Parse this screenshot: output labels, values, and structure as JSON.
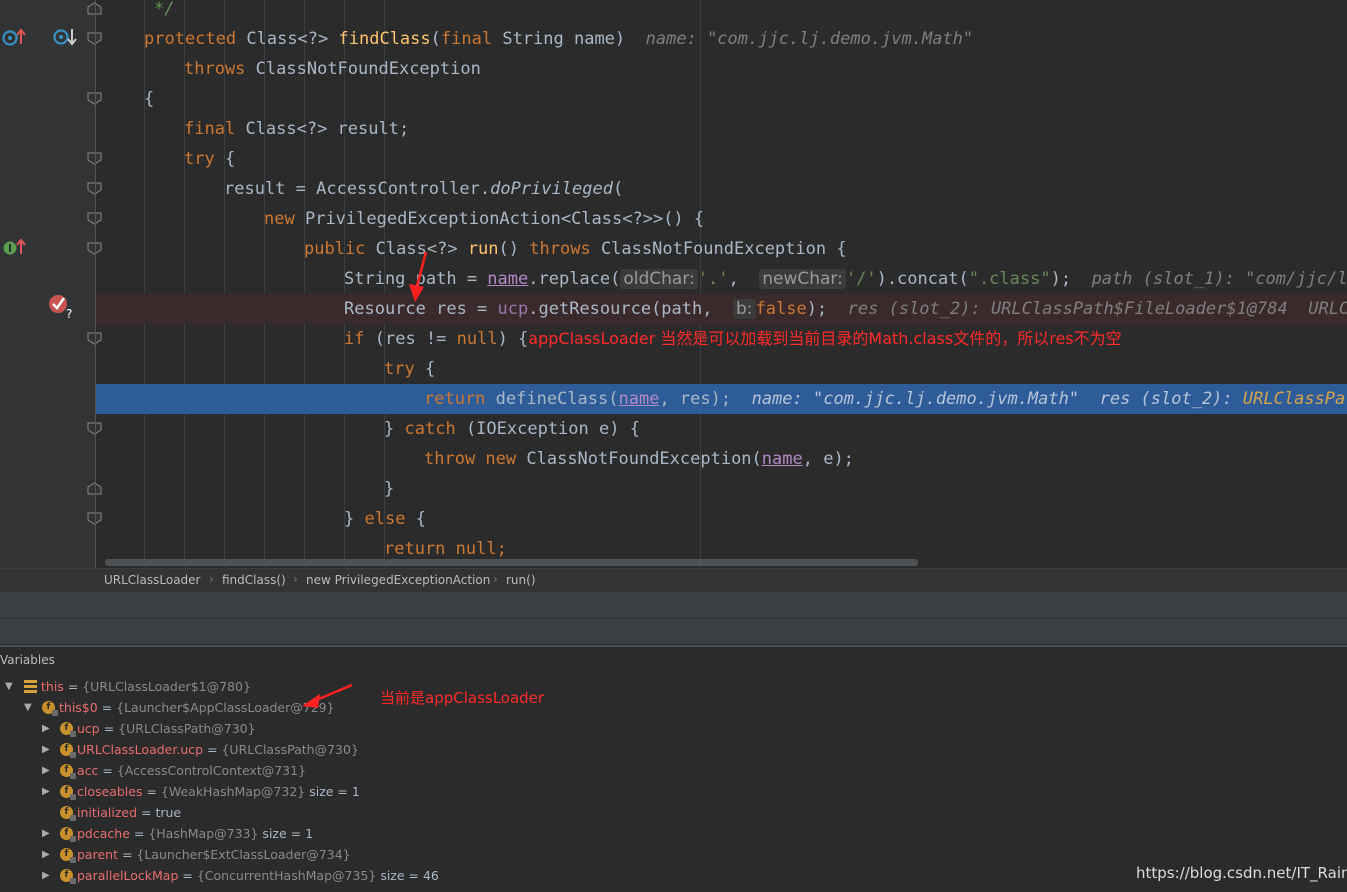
{
  "code_lines": {
    "l0": "*/",
    "l1_protected": "protected",
    "l1_class": "Class<?>",
    "l1_fn": "findClass",
    "l1_paren": "(",
    "l1_final": "final",
    "l1_rest": "String name)",
    "l1_hint": "name: \"com.jjc.lj.demo.jvm.Math\"",
    "l2_throws": "throws",
    "l2_rest": "ClassNotFoundException",
    "l3": "{",
    "l4_final": "final",
    "l4_rest": "Class<?> result;",
    "l5_try": "try",
    "l5_rest": "{",
    "l6_a": "result = AccessController.",
    "l6_fn": "doPrivileged",
    "l6_b": "(",
    "l7_new": "new",
    "l7_rest": "PrivilegedExceptionAction<Class<?>>() {",
    "l8_public": "public",
    "l8_class": "Class<?>",
    "l8_run": "run",
    "l8_paren": "()",
    "l8_throws": "throws",
    "l8_rest": "ClassNotFoundException {",
    "l9_a": "String path = ",
    "l9_name": "name",
    "l9_b": ".replace(",
    "l9_h1": "oldChar:",
    "l9_s1": "'.'",
    "l9_c": ",",
    "l9_h2": "newChar:",
    "l9_s2": "'/'",
    "l9_d": ").concat(",
    "l9_s3": "\".class\"",
    "l9_e": ");",
    "l9_hint": "path (slot_1): \"com/jjc/lj",
    "l10_a": "Resource res = ",
    "l10_ucp": "ucp",
    "l10_b": ".getResource(path,",
    "l10_h": "b:",
    "l10_false": "false",
    "l10_c": ");",
    "l10_hint": "res (slot_2): URLClassPath$FileLoader$1@784  URLCla",
    "l11_if": "if",
    "l11_a": "(res != ",
    "l11_null": "null",
    "l11_b": ") {",
    "l11_anno": "appClassLoader 当然是可以加载到当前目录的Math.class文件的，所以res不为空",
    "l12_try": "try",
    "l12_rest": "{",
    "l13_return": "return",
    "l13_a": "defineClass(",
    "l13_name": "name",
    "l13_b": ", res);",
    "l13_hint1": "name: \"com.jjc.lj.demo.jvm.Math\"",
    "l13_hint2": "res (slot_2):",
    "l13_hint3": "URLClassPath",
    "l14_a": "}",
    "l14_catch": "catch",
    "l14_b": "(IOException e) {",
    "l15_throw": "throw new",
    "l15_a": "ClassNotFoundException(",
    "l15_name": "name",
    "l15_b": ", e);",
    "l16": "}",
    "l17_a": "}",
    "l17_else": "else",
    "l17_b": "{",
    "l18_return": "return",
    "l18_null": "null;"
  },
  "breadcrumbs": [
    "URLClassLoader",
    "findClass()",
    "new PrivilegedExceptionAction",
    "run()"
  ],
  "variables": {
    "title": "Variables",
    "rows": [
      {
        "name": "this",
        "eq": " = ",
        "val": "{URLClassLoader$1@780}",
        "extra": ""
      },
      {
        "name": "this$0",
        "eq": " = ",
        "val": "{Launcher$AppClassLoader@729}",
        "extra": ""
      },
      {
        "name": "ucp",
        "eq": " = ",
        "val": "{URLClassPath@730}",
        "extra": ""
      },
      {
        "name": "URLClassLoader.ucp",
        "eq": " = ",
        "val": "{URLClassPath@730}",
        "extra": ""
      },
      {
        "name": "acc",
        "eq": " = ",
        "val": "{AccessControlContext@731}",
        "extra": ""
      },
      {
        "name": "closeables",
        "eq": " = ",
        "val": "{WeakHashMap@732}",
        "extra": "  size = 1"
      },
      {
        "name": "initialized",
        "eq": " = ",
        "val": "true",
        "extra": ""
      },
      {
        "name": "pdcache",
        "eq": " = ",
        "val": "{HashMap@733}",
        "extra": "  size = 1"
      },
      {
        "name": "parent",
        "eq": " = ",
        "val": "{Launcher$ExtClassLoader@734}",
        "extra": ""
      },
      {
        "name": "parallelLockMap",
        "eq": " = ",
        "val": "{ConcurrentHashMap@735}",
        "extra": "  size = 46"
      }
    ]
  },
  "annotation_current": "当前是appClassLoader",
  "watermark": "https://blog.csdn.net/IT_Rain",
  "colors": {
    "exec_line": "#2d5c98",
    "breakpoint": "#c0392b",
    "annotation": "#ff2a2a"
  }
}
